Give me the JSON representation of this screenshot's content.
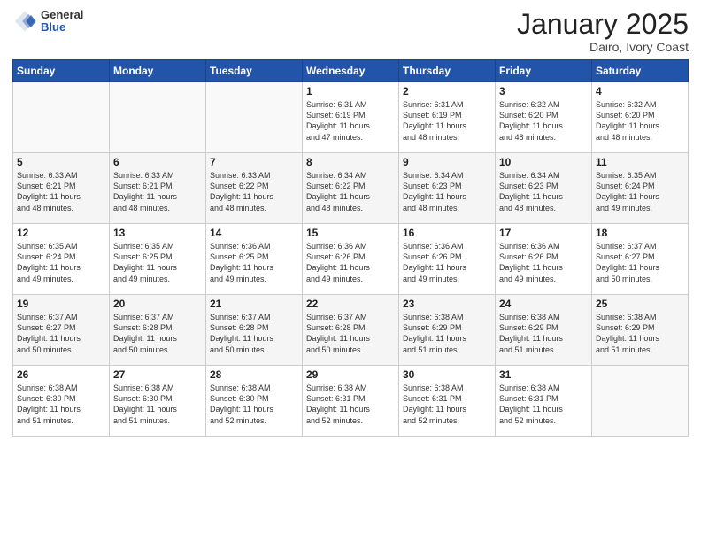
{
  "header": {
    "logo_general": "General",
    "logo_blue": "Blue",
    "month_title": "January 2025",
    "location": "Dairo, Ivory Coast"
  },
  "weekdays": [
    "Sunday",
    "Monday",
    "Tuesday",
    "Wednesday",
    "Thursday",
    "Friday",
    "Saturday"
  ],
  "weeks": [
    [
      {
        "day": "",
        "content": ""
      },
      {
        "day": "",
        "content": ""
      },
      {
        "day": "",
        "content": ""
      },
      {
        "day": "1",
        "content": "Sunrise: 6:31 AM\nSunset: 6:19 PM\nDaylight: 11 hours\nand 47 minutes."
      },
      {
        "day": "2",
        "content": "Sunrise: 6:31 AM\nSunset: 6:19 PM\nDaylight: 11 hours\nand 48 minutes."
      },
      {
        "day": "3",
        "content": "Sunrise: 6:32 AM\nSunset: 6:20 PM\nDaylight: 11 hours\nand 48 minutes."
      },
      {
        "day": "4",
        "content": "Sunrise: 6:32 AM\nSunset: 6:20 PM\nDaylight: 11 hours\nand 48 minutes."
      }
    ],
    [
      {
        "day": "5",
        "content": "Sunrise: 6:33 AM\nSunset: 6:21 PM\nDaylight: 11 hours\nand 48 minutes."
      },
      {
        "day": "6",
        "content": "Sunrise: 6:33 AM\nSunset: 6:21 PM\nDaylight: 11 hours\nand 48 minutes."
      },
      {
        "day": "7",
        "content": "Sunrise: 6:33 AM\nSunset: 6:22 PM\nDaylight: 11 hours\nand 48 minutes."
      },
      {
        "day": "8",
        "content": "Sunrise: 6:34 AM\nSunset: 6:22 PM\nDaylight: 11 hours\nand 48 minutes."
      },
      {
        "day": "9",
        "content": "Sunrise: 6:34 AM\nSunset: 6:23 PM\nDaylight: 11 hours\nand 48 minutes."
      },
      {
        "day": "10",
        "content": "Sunrise: 6:34 AM\nSunset: 6:23 PM\nDaylight: 11 hours\nand 48 minutes."
      },
      {
        "day": "11",
        "content": "Sunrise: 6:35 AM\nSunset: 6:24 PM\nDaylight: 11 hours\nand 49 minutes."
      }
    ],
    [
      {
        "day": "12",
        "content": "Sunrise: 6:35 AM\nSunset: 6:24 PM\nDaylight: 11 hours\nand 49 minutes."
      },
      {
        "day": "13",
        "content": "Sunrise: 6:35 AM\nSunset: 6:25 PM\nDaylight: 11 hours\nand 49 minutes."
      },
      {
        "day": "14",
        "content": "Sunrise: 6:36 AM\nSunset: 6:25 PM\nDaylight: 11 hours\nand 49 minutes."
      },
      {
        "day": "15",
        "content": "Sunrise: 6:36 AM\nSunset: 6:26 PM\nDaylight: 11 hours\nand 49 minutes."
      },
      {
        "day": "16",
        "content": "Sunrise: 6:36 AM\nSunset: 6:26 PM\nDaylight: 11 hours\nand 49 minutes."
      },
      {
        "day": "17",
        "content": "Sunrise: 6:36 AM\nSunset: 6:26 PM\nDaylight: 11 hours\nand 49 minutes."
      },
      {
        "day": "18",
        "content": "Sunrise: 6:37 AM\nSunset: 6:27 PM\nDaylight: 11 hours\nand 50 minutes."
      }
    ],
    [
      {
        "day": "19",
        "content": "Sunrise: 6:37 AM\nSunset: 6:27 PM\nDaylight: 11 hours\nand 50 minutes."
      },
      {
        "day": "20",
        "content": "Sunrise: 6:37 AM\nSunset: 6:28 PM\nDaylight: 11 hours\nand 50 minutes."
      },
      {
        "day": "21",
        "content": "Sunrise: 6:37 AM\nSunset: 6:28 PM\nDaylight: 11 hours\nand 50 minutes."
      },
      {
        "day": "22",
        "content": "Sunrise: 6:37 AM\nSunset: 6:28 PM\nDaylight: 11 hours\nand 50 minutes."
      },
      {
        "day": "23",
        "content": "Sunrise: 6:38 AM\nSunset: 6:29 PM\nDaylight: 11 hours\nand 51 minutes."
      },
      {
        "day": "24",
        "content": "Sunrise: 6:38 AM\nSunset: 6:29 PM\nDaylight: 11 hours\nand 51 minutes."
      },
      {
        "day": "25",
        "content": "Sunrise: 6:38 AM\nSunset: 6:29 PM\nDaylight: 11 hours\nand 51 minutes."
      }
    ],
    [
      {
        "day": "26",
        "content": "Sunrise: 6:38 AM\nSunset: 6:30 PM\nDaylight: 11 hours\nand 51 minutes."
      },
      {
        "day": "27",
        "content": "Sunrise: 6:38 AM\nSunset: 6:30 PM\nDaylight: 11 hours\nand 51 minutes."
      },
      {
        "day": "28",
        "content": "Sunrise: 6:38 AM\nSunset: 6:30 PM\nDaylight: 11 hours\nand 52 minutes."
      },
      {
        "day": "29",
        "content": "Sunrise: 6:38 AM\nSunset: 6:31 PM\nDaylight: 11 hours\nand 52 minutes."
      },
      {
        "day": "30",
        "content": "Sunrise: 6:38 AM\nSunset: 6:31 PM\nDaylight: 11 hours\nand 52 minutes."
      },
      {
        "day": "31",
        "content": "Sunrise: 6:38 AM\nSunset: 6:31 PM\nDaylight: 11 hours\nand 52 minutes."
      },
      {
        "day": "",
        "content": ""
      }
    ]
  ]
}
